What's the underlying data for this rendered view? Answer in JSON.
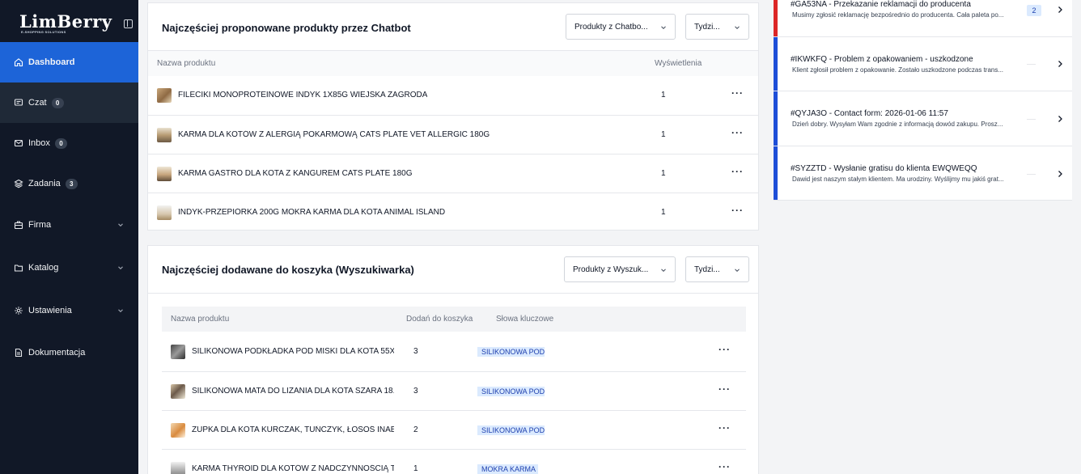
{
  "brand": {
    "logo_text": "LimBerry",
    "logo_subtitle": "E-SHOPPING SOLUTIONS"
  },
  "sidebar": {
    "items": [
      {
        "label": "Dashboard",
        "icon": "home-icon",
        "active": true
      },
      {
        "label": "Czat",
        "icon": "chat-icon",
        "badge": "0"
      },
      {
        "label": "Inbox",
        "icon": "mail-icon",
        "badge": "0"
      },
      {
        "label": "Zadania",
        "icon": "layers-icon",
        "badge": "3"
      },
      {
        "label": "Firma",
        "icon": "building-icon",
        "expandable": true
      },
      {
        "label": "Katalog",
        "icon": "folder-icon",
        "expandable": true
      },
      {
        "label": "Ustawienia",
        "icon": "gear-icon",
        "expandable": true
      },
      {
        "label": "Dokumentacja",
        "icon": "document-icon"
      }
    ]
  },
  "chatbot_card": {
    "title": "Najczęściej proponowane produkty przez Chatbot",
    "source_select": "Produkty z Chatbo...",
    "period_select": "Tydzi...",
    "columns": {
      "name": "Nazwa produktu",
      "views": "Wyświetlenia"
    },
    "rows": [
      {
        "name": "FILECIKI MONOPROTEINOWE INDYK 1X85G WIEJSKA ZAGRODA",
        "views": "1"
      },
      {
        "name": "KARMA DLA KOTÓW Z ALERGIĄ POKARMOWĄ CATS PLATE VET ALLERGIC 180G",
        "views": "1"
      },
      {
        "name": "KARMA GASTRO DLA KOTA Z KANGUREM CATS PLATE 180G",
        "views": "1"
      },
      {
        "name": "INDYK-PRZEPIÓRKA 200G MOKRA KARMA DLA KOTA ANIMAL ISLAND",
        "views": "1"
      }
    ]
  },
  "cart_card": {
    "title": "Najczęściej dodawane do koszyka (Wyszukiwarka)",
    "source_select": "Produkty z Wyszuk...",
    "period_select": "Tydzi...",
    "columns": {
      "name": "Nazwa produktu",
      "added": "Dodań do koszyka",
      "keywords": "Słowa kluczowe"
    },
    "rows": [
      {
        "name": "SILIKONOWA PODKŁADKA POD MISKI DLA KOTA 55X...",
        "added": "3",
        "keyword": "SILIKONOWA POD"
      },
      {
        "name": "SILIKONOWA MATA DO LIZANIA DLA KOTA SZARA 18...",
        "added": "3",
        "keyword": "SILIKONOWA POD"
      },
      {
        "name": "ZUPKA DLA KOTA KURCZAK, TUŃCZYK, ŁOSOŚ INAB...",
        "added": "2",
        "keyword": "SILIKONOWA POD"
      },
      {
        "name": "KARMA THYROID DLA KOTÓW Z NADCZYNNOŚCIĄ T...",
        "added": "1",
        "keyword": "MOKRA KARMA"
      }
    ]
  },
  "tickets": [
    {
      "title": "#GA53NA - Przekazanie reklamacji do producenta",
      "preview": "Musimy zgłosić reklamację bezpośrednio do producenta. Cała paleta po...",
      "count": "2",
      "color": "#dc2626"
    },
    {
      "title": "#IKWKFQ - Problem z opakowaniem - uszkodzone",
      "preview": "Klient zgłosił problem z opakowanie. Zostało uszkodzone podczas trans...",
      "color": "#1d4ed8"
    },
    {
      "title": "#QYJA3O - Contact form: 2026-01-06 11:57",
      "preview": "Dzień dobry. Wysyłam Wam zgodnie z informacją dowód zakupu. Prosz...",
      "color": "#1d4ed8"
    },
    {
      "title": "#SYZZTD - Wysłanie gratisu do klienta EWQWEQQ",
      "preview": "Dawid jest naszym stałym klientem. Ma urodziny. Wyślijmy mu jakiś grat...",
      "color": "#1d4ed8"
    }
  ]
}
